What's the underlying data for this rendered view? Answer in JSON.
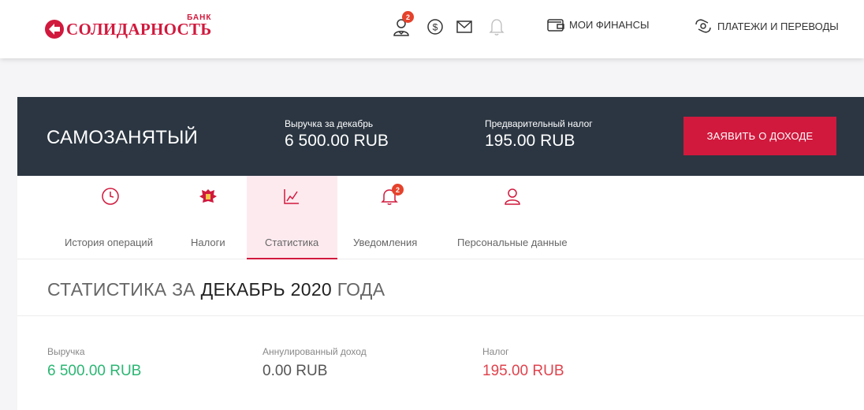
{
  "header": {
    "logo": {
      "bank": "БАНК",
      "name": "СОЛИДАРНОСТЬ"
    },
    "notifications_badge": "2",
    "links": {
      "finances": "МОИ ФИНАНСЫ",
      "payments": "ПЛАТЕЖИ И ПЕРЕВОДЫ"
    },
    "icons": [
      "profile-icon",
      "dollar-icon",
      "mail-icon",
      "bell-icon",
      "wallet-icon",
      "transfer-icon"
    ]
  },
  "banner": {
    "title": "САМОЗАНЯТЫЙ",
    "revenue_label": "Выручка за декабрь",
    "revenue_value": "6 500.00 RUB",
    "tax_label": "Предварительный налог",
    "tax_value": "195.00 RUB",
    "declare_button": "ЗАЯВИТЬ О ДОХОДЕ"
  },
  "tabs": [
    {
      "label": "История операций",
      "icon": "clock-icon",
      "active": false
    },
    {
      "label": "Налоги",
      "icon": "emblem-icon",
      "active": false
    },
    {
      "label": "Статистика",
      "icon": "chart-icon",
      "active": true
    },
    {
      "label": "Уведомления",
      "icon": "bell-icon",
      "active": false,
      "badge": "2"
    },
    {
      "label": "Персональные данные",
      "icon": "person-icon",
      "active": false
    }
  ],
  "statistics": {
    "title_prefix": "СТАТИСТИКА ЗА",
    "title_period": "ДЕКАБРЬ 2020",
    "title_suffix": "ГОДА",
    "metrics": [
      {
        "label": "Выручка",
        "value": "6 500.00 RUB"
      },
      {
        "label": "Аннулированный доход",
        "value": "0.00 RUB"
      },
      {
        "label": "Налог",
        "value": "195.00 RUB"
      }
    ]
  },
  "colors": {
    "brand": "#d1193d",
    "banner": "#2b3642",
    "positive": "#2bb673",
    "tax": "#e0434d",
    "active_tab_bg": "#fdeaef"
  }
}
